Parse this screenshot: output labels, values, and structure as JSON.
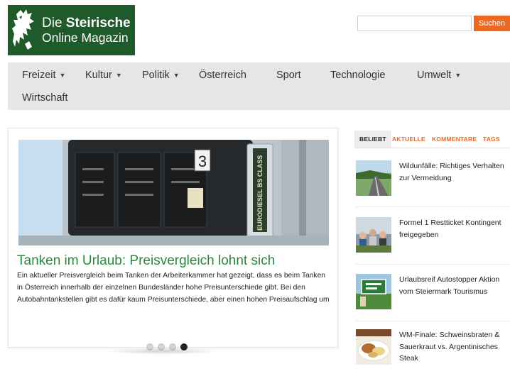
{
  "logo": {
    "line1_prefix": "Die ",
    "line1_bold": "Steirische",
    "line2": "Online Magazin"
  },
  "search": {
    "placeholder": "",
    "button_label": "Suchen"
  },
  "nav": {
    "items": [
      {
        "label": "Freizeit",
        "has_dropdown": true
      },
      {
        "label": "Kultur",
        "has_dropdown": true
      },
      {
        "label": "Politik",
        "has_dropdown": true
      },
      {
        "label": "Österreich",
        "has_dropdown": false
      },
      {
        "label": "Sport",
        "has_dropdown": false
      },
      {
        "label": "Technologie",
        "has_dropdown": false
      },
      {
        "label": "Umwelt",
        "has_dropdown": true
      },
      {
        "label": "Wirtschaft",
        "has_dropdown": false
      }
    ],
    "caret": "▼"
  },
  "slider": {
    "title": "Tanken im Urlaub: Preisvergleich lohnt sich",
    "text": "Ein aktueller Preisvergleich beim Tanken der Arbeiterkammer hat gezeigt, dass es beim Tanken in Österreich innerhalb der einzelnen Bundesländer hohe Preisunterschiede gibt. Bei den Autobahntankstellen gibt es dafür kaum Preisunterschiede, aber einen hohen Preisaufschlag um",
    "image_pump_number": "3",
    "image_pump_label": "EURODIESEL BS CLASS",
    "dots": 4,
    "active_dot": 3
  },
  "sidebar": {
    "tabs": [
      "BELIEBT",
      "AKTUELLE",
      "KOMMENTARE",
      "TAGS"
    ],
    "active_tab": 0,
    "items": [
      {
        "text": "Wildunfälle: Richtiges Verhalten zur Vermeidung",
        "thumb": "road-thumbnail"
      },
      {
        "text": "Formel 1 Restticket Kontingent freigegeben",
        "thumb": "crowd-thumbnail"
      },
      {
        "text": "Urlaubsreif Autostopper Aktion vom Steiermark Tourismus",
        "thumb": "sign-thumbnail"
      },
      {
        "text": "WM-Finale: Schweinsbraten & Sauerkraut vs. Argentinisches Steak",
        "thumb": "food-thumbnail"
      }
    ]
  },
  "colors": {
    "brand_green": "#1f5a2a",
    "accent_orange": "#ea6a24",
    "title_green": "#2a8a3a",
    "nav_bg": "#e6e6e6"
  }
}
